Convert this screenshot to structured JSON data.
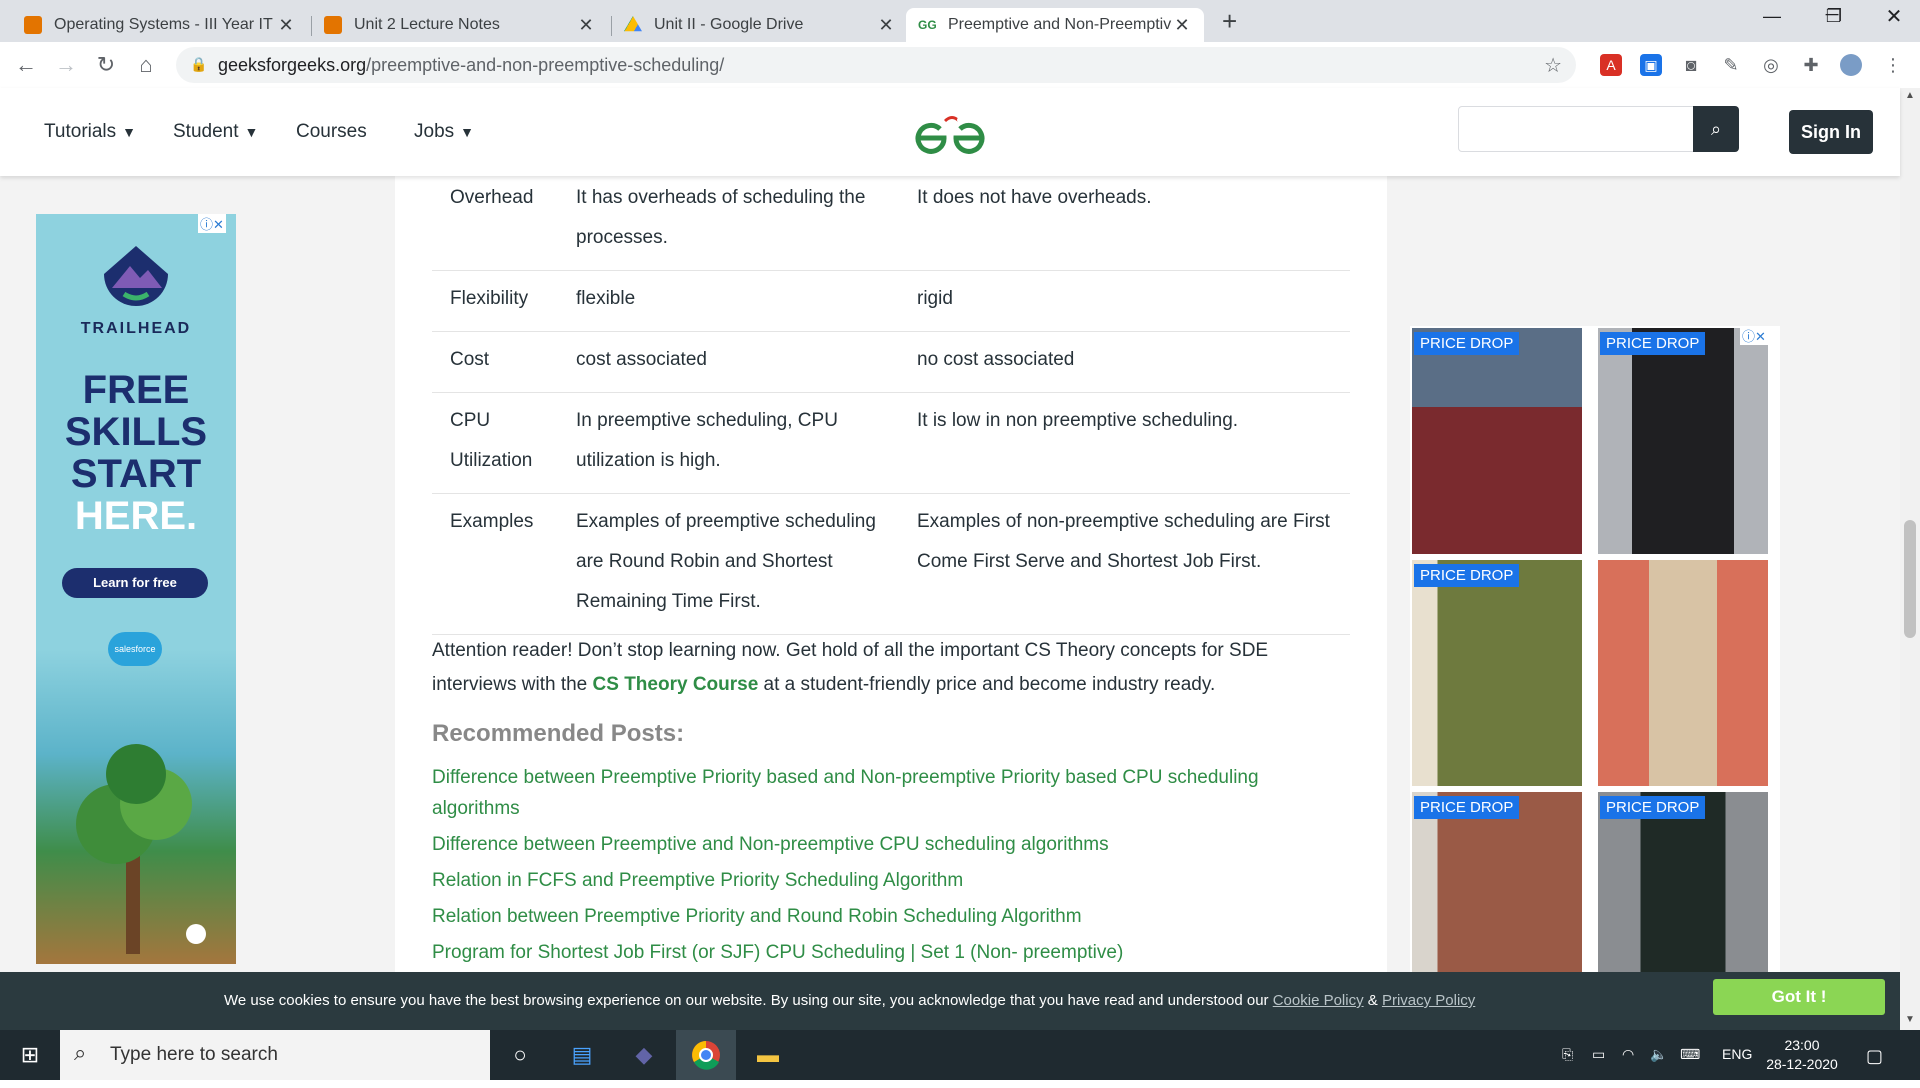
{
  "browser": {
    "tabs": [
      {
        "title": "Operating Systems - III Year IT (B",
        "favicon_color": "#e37400"
      },
      {
        "title": "Unit 2 Lecture Notes",
        "favicon_color": "#e37400"
      },
      {
        "title": "Unit II - Google Drive",
        "favicon_color": "#fbbc04"
      },
      {
        "title": "Preemptive and Non-Preemptive",
        "favicon_color": "#2f8d46"
      }
    ],
    "active_tab_index": 3,
    "url_domain": "geeksforgeeks.org",
    "url_path": "/preemptive-and-non-preemptive-scheduling/"
  },
  "site_header": {
    "menu": [
      {
        "label": "Tutorials",
        "dropdown": true
      },
      {
        "label": "Student",
        "dropdown": true
      },
      {
        "label": "Courses",
        "dropdown": false
      },
      {
        "label": "Jobs",
        "dropdown": true
      }
    ],
    "search_placeholder": "",
    "signin_label": "Sign In",
    "brand_color": "#2f8d46"
  },
  "table": {
    "rows": [
      {
        "aspect": "Overhead",
        "preemptive": "It has overheads of scheduling the processes.",
        "non_preemptive": "It does not have overheads."
      },
      {
        "aspect": "Flexibility",
        "preemptive": "flexible",
        "non_preemptive": "rigid"
      },
      {
        "aspect": "Cost",
        "preemptive": "cost associated",
        "non_preemptive": "no cost associated"
      },
      {
        "aspect": "CPU Utilization",
        "preemptive": "In preemptive scheduling, CPU utilization is high.",
        "non_preemptive": "It is low in non preemptive scheduling."
      },
      {
        "aspect": "Examples",
        "preemptive": "Examples of preemptive scheduling are Round Robin and Shortest Remaining Time First.",
        "non_preemptive": "Examples of non-preemptive scheduling are First Come First Serve and Shortest Job First."
      }
    ]
  },
  "attention": {
    "before": "Attention reader! Don’t stop learning now. Get hold of all the important CS Theory concepts for SDE interviews with the ",
    "link": "CS Theory Course",
    "after": " at a student-friendly price and become industry ready."
  },
  "recommended": {
    "title": "Recommended Posts:",
    "links": [
      "Difference between Preemptive Priority based and Non-preemptive Priority based CPU scheduling algorithms",
      "Difference between Preemptive and Non-preemptive CPU scheduling algorithms",
      "Relation in FCFS and Preemptive Priority Scheduling Algorithm",
      "Relation between Preemptive Priority and Round Robin Scheduling Algorithm",
      "Program for Shortest Job First (or SJF) CPU Scheduling | Set 1 (Non- preemptive)"
    ]
  },
  "ad_left": {
    "brand": "TRAILHEAD",
    "headline_lines": [
      "FREE",
      "SKILLS",
      "START",
      "HERE."
    ],
    "cta": "Learn for free",
    "sponsor": "salesforce"
  },
  "ad_right": {
    "badge": "PRICE DROP",
    "products": [
      {
        "badge": true,
        "bg": "#7a2a2e"
      },
      {
        "badge": true,
        "bg": "#2a2a2e"
      },
      {
        "badge": true,
        "bg": "#6e7a3e"
      },
      {
        "badge": false,
        "bg": "#d8705a"
      },
      {
        "badge": true,
        "bg": "#9a5a46"
      },
      {
        "badge": true,
        "bg": "#2f3a36"
      }
    ]
  },
  "cookie": {
    "message": "We use cookies to ensure you have the best browsing experience on our website. By using our site, you acknowledge that you have read and understood our ",
    "cookie_policy": "Cookie Policy",
    "amp": " & ",
    "privacy_policy": "Privacy Policy",
    "button": "Got It !"
  },
  "taskbar": {
    "search_placeholder": "Type here to search",
    "language": "ENG",
    "time": "23:00",
    "date": "28-12-2020"
  }
}
